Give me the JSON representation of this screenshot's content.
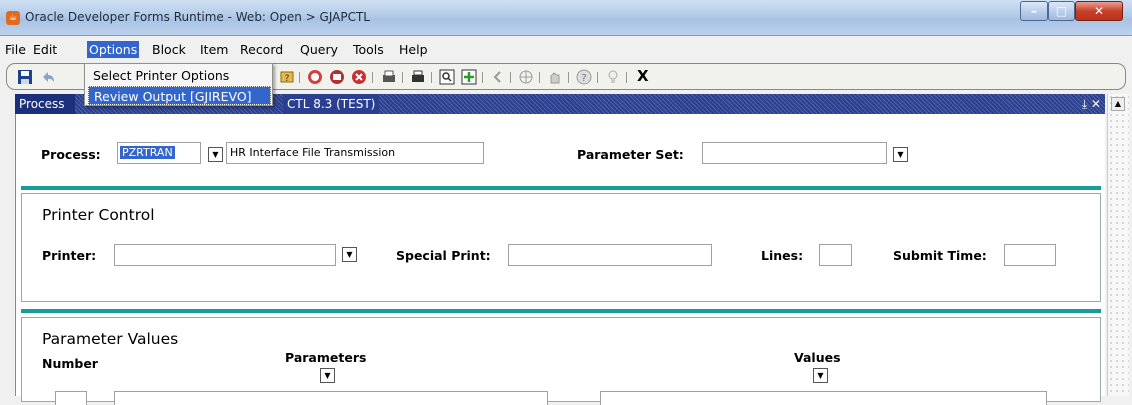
{
  "window": {
    "title": "Oracle Developer Forms Runtime - Web:  Open > GJAPCTL"
  },
  "menu": {
    "items": [
      "File",
      "Edit",
      "Options",
      "Block",
      "Item",
      "Record",
      "Query",
      "Tools",
      "Help"
    ],
    "active": "Options"
  },
  "options_menu": {
    "items": [
      "Select Printer Options",
      "Review Output [GJIREVO]"
    ],
    "highlighted": "Review Output [GJIREVO]"
  },
  "toolbar": {
    "exit_label": "X"
  },
  "inner_window": {
    "title_left": "Process",
    "title_right": "CTL  8.3  (TEST)"
  },
  "process": {
    "label": "Process:",
    "code": "PZRTRAN",
    "description": "HR Interface File Transmission",
    "parameter_set_label": "Parameter Set:",
    "parameter_set_value": ""
  },
  "printer_control": {
    "title": "Printer Control",
    "printer_label": "Printer:",
    "printer_value": "",
    "special_print_label": "Special Print:",
    "special_print_value": "",
    "lines_label": "Lines:",
    "lines_value": "",
    "submit_time_label": "Submit Time:",
    "submit_time_value": ""
  },
  "parameter_values": {
    "title": "Parameter Values",
    "number_label": "Number",
    "parameters_label": "Parameters",
    "values_label": "Values"
  },
  "colors": {
    "accent_teal": "#1a9b9b",
    "menu_highlight": "#3366cc",
    "inner_title": "#2a3f8f"
  }
}
